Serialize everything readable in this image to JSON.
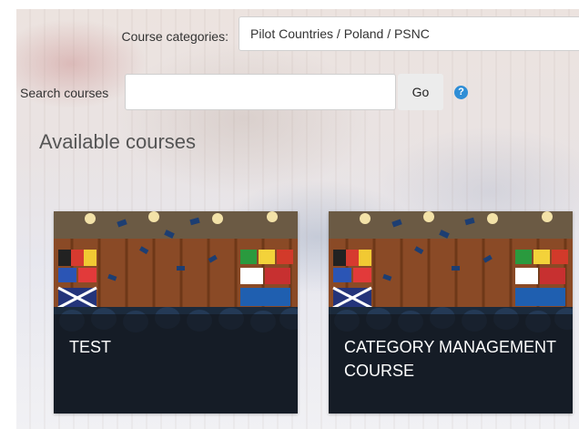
{
  "filters": {
    "category_label": "Course categories:",
    "category_value": "Pilot Countries / Poland / PSNC",
    "search_label": "Search courses",
    "search_value": "",
    "go_label": "Go",
    "help_icon": "question-circle-icon"
  },
  "heading": "Available courses",
  "courses": [
    {
      "title": "TEST",
      "image": "graduation-ceremony-photo"
    },
    {
      "title": "CATEGORY MANAGEMENT COURSE",
      "image": "graduation-ceremony-photo"
    }
  ],
  "colors": {
    "help_icon": "#2f8ed6",
    "card_overlay": "#14181e",
    "go_button_bg": "#ececec"
  }
}
